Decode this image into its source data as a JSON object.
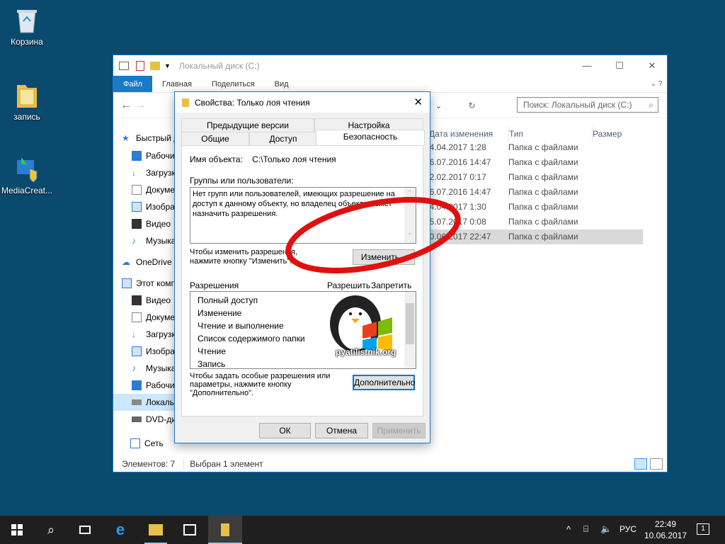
{
  "desktop": {
    "icons": [
      {
        "label": "Корзина"
      },
      {
        "label": "запись"
      },
      {
        "label": "MediaCreat..."
      }
    ]
  },
  "explorer": {
    "title": "Локальный диск (C:)",
    "ribbon_tabs": [
      "Файл",
      "Главная",
      "Поделиться",
      "Вид"
    ],
    "search_placeholder": "Поиск: Локальный диск (C:)",
    "nav": [
      {
        "label": "Быстрый доступ"
      },
      {
        "label": "Рабочий стол"
      },
      {
        "label": "Загрузки"
      },
      {
        "label": "Документы"
      },
      {
        "label": "Изображения"
      },
      {
        "label": "Видео"
      },
      {
        "label": "Музыка"
      },
      {
        "label": "OneDrive"
      },
      {
        "label": "Этот компьютер"
      },
      {
        "label": "Видео"
      },
      {
        "label": "Документы"
      },
      {
        "label": "Загрузки"
      },
      {
        "label": "Изображения"
      },
      {
        "label": "Музыка"
      },
      {
        "label": "Рабочий стол"
      },
      {
        "label": "Локальный диск (C:)"
      },
      {
        "label": "DVD-дисковод"
      },
      {
        "label": "Сеть"
      }
    ],
    "columns": {
      "date": "Дата изменения",
      "type": "Тип",
      "size": "Размер"
    },
    "files": [
      {
        "date": "04.04.2017 1:28",
        "type": "Папка с файлами"
      },
      {
        "date": "16.07.2016 14:47",
        "type": "Папка с файлами"
      },
      {
        "date": "02.02.2017 0:17",
        "type": "Папка с файлами"
      },
      {
        "date": "16.07.2016 14:47",
        "type": "Папка с файлами"
      },
      {
        "date": "04.04.2017 1:30",
        "type": "Папка с файлами"
      },
      {
        "date": "05.07.2017 0:08",
        "type": "Папка с файлами"
      },
      {
        "date": "10.06.2017 22:47",
        "type": "Папка с файлами"
      }
    ],
    "status_items": "Элементов: 7",
    "status_selected": "Выбран 1 элемент"
  },
  "dialog": {
    "title": "Свойства: Только лоя чтения",
    "tabs_back": [
      "Предыдущие версии",
      "Настройка"
    ],
    "tabs_front": [
      "Общие",
      "Доступ",
      "Безопасность"
    ],
    "object_label": "Имя объекта:",
    "object_value": "C:\\Только лоя чтения",
    "groups_label": "Группы или пользователи:",
    "groups_text": "Нет групп или пользователей, имеющих разрешение на доступ к данному объекту, но владелец объекта может назначить разрешения.",
    "change_hint": "Чтобы изменить разрешения, нажмите кнопку \"Изменить\".",
    "change_button": "Изменить...",
    "perm_header": "Разрешения",
    "perm_allow": "Разрешить",
    "perm_deny": "Запретить",
    "permissions": [
      "Полный доступ",
      "Изменение",
      "Чтение и выполнение",
      "Список содержимого папки",
      "Чтение",
      "Запись"
    ],
    "advanced_hint": "Чтобы задать особые разрешения или параметры, нажмите кнопку \"Дополнительно\".",
    "advanced_button": "Дополнительно",
    "ok": "ОК",
    "cancel": "Отмена",
    "apply": "Применить",
    "watermark": "pyatilistnik.org"
  },
  "taskbar": {
    "lang": "РУС",
    "time": "22:49",
    "date": "10.06.2017",
    "notifications": "1"
  },
  "colors": {
    "accent": "#1979ca",
    "highlight": "#ff0000"
  }
}
